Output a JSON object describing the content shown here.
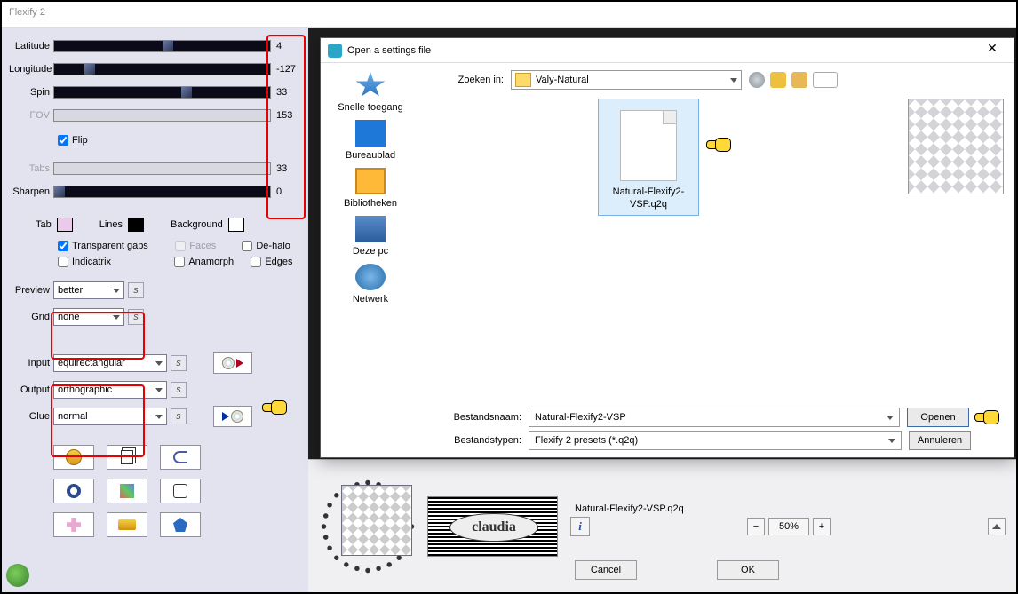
{
  "app": {
    "title": "Flexify 2"
  },
  "sliders": {
    "latitude": {
      "label": "Latitude",
      "value": "4",
      "thumb_pct": 50,
      "enabled": true
    },
    "longitude": {
      "label": "Longitude",
      "value": "-127",
      "thumb_pct": 14,
      "enabled": true
    },
    "spin": {
      "label": "Spin",
      "value": "33",
      "thumb_pct": 60,
      "enabled": true
    },
    "fov": {
      "label": "FOV",
      "value": "153",
      "enabled": false
    },
    "tabs": {
      "label": "Tabs",
      "value": "33",
      "enabled": false
    },
    "sharpen": {
      "label": "Sharpen",
      "value": "0",
      "thumb_pct": 0,
      "enabled": true
    }
  },
  "flip": {
    "label": "Flip",
    "checked": true
  },
  "colors": {
    "tab": {
      "label": "Tab",
      "hex": "#eacaea"
    },
    "lines": {
      "label": "Lines",
      "hex": "#000000"
    },
    "background": {
      "label": "Background",
      "hex": "#ffffff"
    }
  },
  "checks": {
    "transparent_gaps": {
      "label": "Transparent gaps",
      "checked": true,
      "enabled": true
    },
    "faces": {
      "label": "Faces",
      "checked": false,
      "enabled": false
    },
    "de_halo": {
      "label": "De-halo",
      "checked": false,
      "enabled": true
    },
    "indicatrix": {
      "label": "Indicatrix",
      "checked": false,
      "enabled": true
    },
    "anamorph": {
      "label": "Anamorph",
      "checked": false,
      "enabled": true
    },
    "edges": {
      "label": "Edges",
      "checked": false,
      "enabled": true
    }
  },
  "combos": {
    "preview": {
      "label": "Preview",
      "value": "better"
    },
    "grid": {
      "label": "Grid",
      "value": "none"
    },
    "input": {
      "label": "Input",
      "value": "equirectangular"
    },
    "output": {
      "label": "Output",
      "value": "orthographic"
    },
    "glue": {
      "label": "Glue",
      "value": "normal"
    }
  },
  "bottom": {
    "preset_name": "Natural-Flexify2-VSP.q2q",
    "zoom": "50%",
    "cancel": "Cancel",
    "ok": "OK",
    "info": "i"
  },
  "dialog": {
    "title": "Open a settings file",
    "lookin_label": "Zoeken in:",
    "lookin_value": "Valy-Natural",
    "sidebar": {
      "quick": "Snelle toegang",
      "desktop": "Bureaublad",
      "libs": "Bibliotheken",
      "pc": "Deze pc",
      "net": "Netwerk"
    },
    "file_item": "Natural-Flexify2-VSP.q2q",
    "filename_label": "Bestandsnaam:",
    "filename_value": "Natural-Flexify2-VSP",
    "filetype_label": "Bestandstypen:",
    "filetype_value": "Flexify 2 presets (*.q2q)",
    "open": "Openen",
    "cancel": "Annuleren"
  }
}
